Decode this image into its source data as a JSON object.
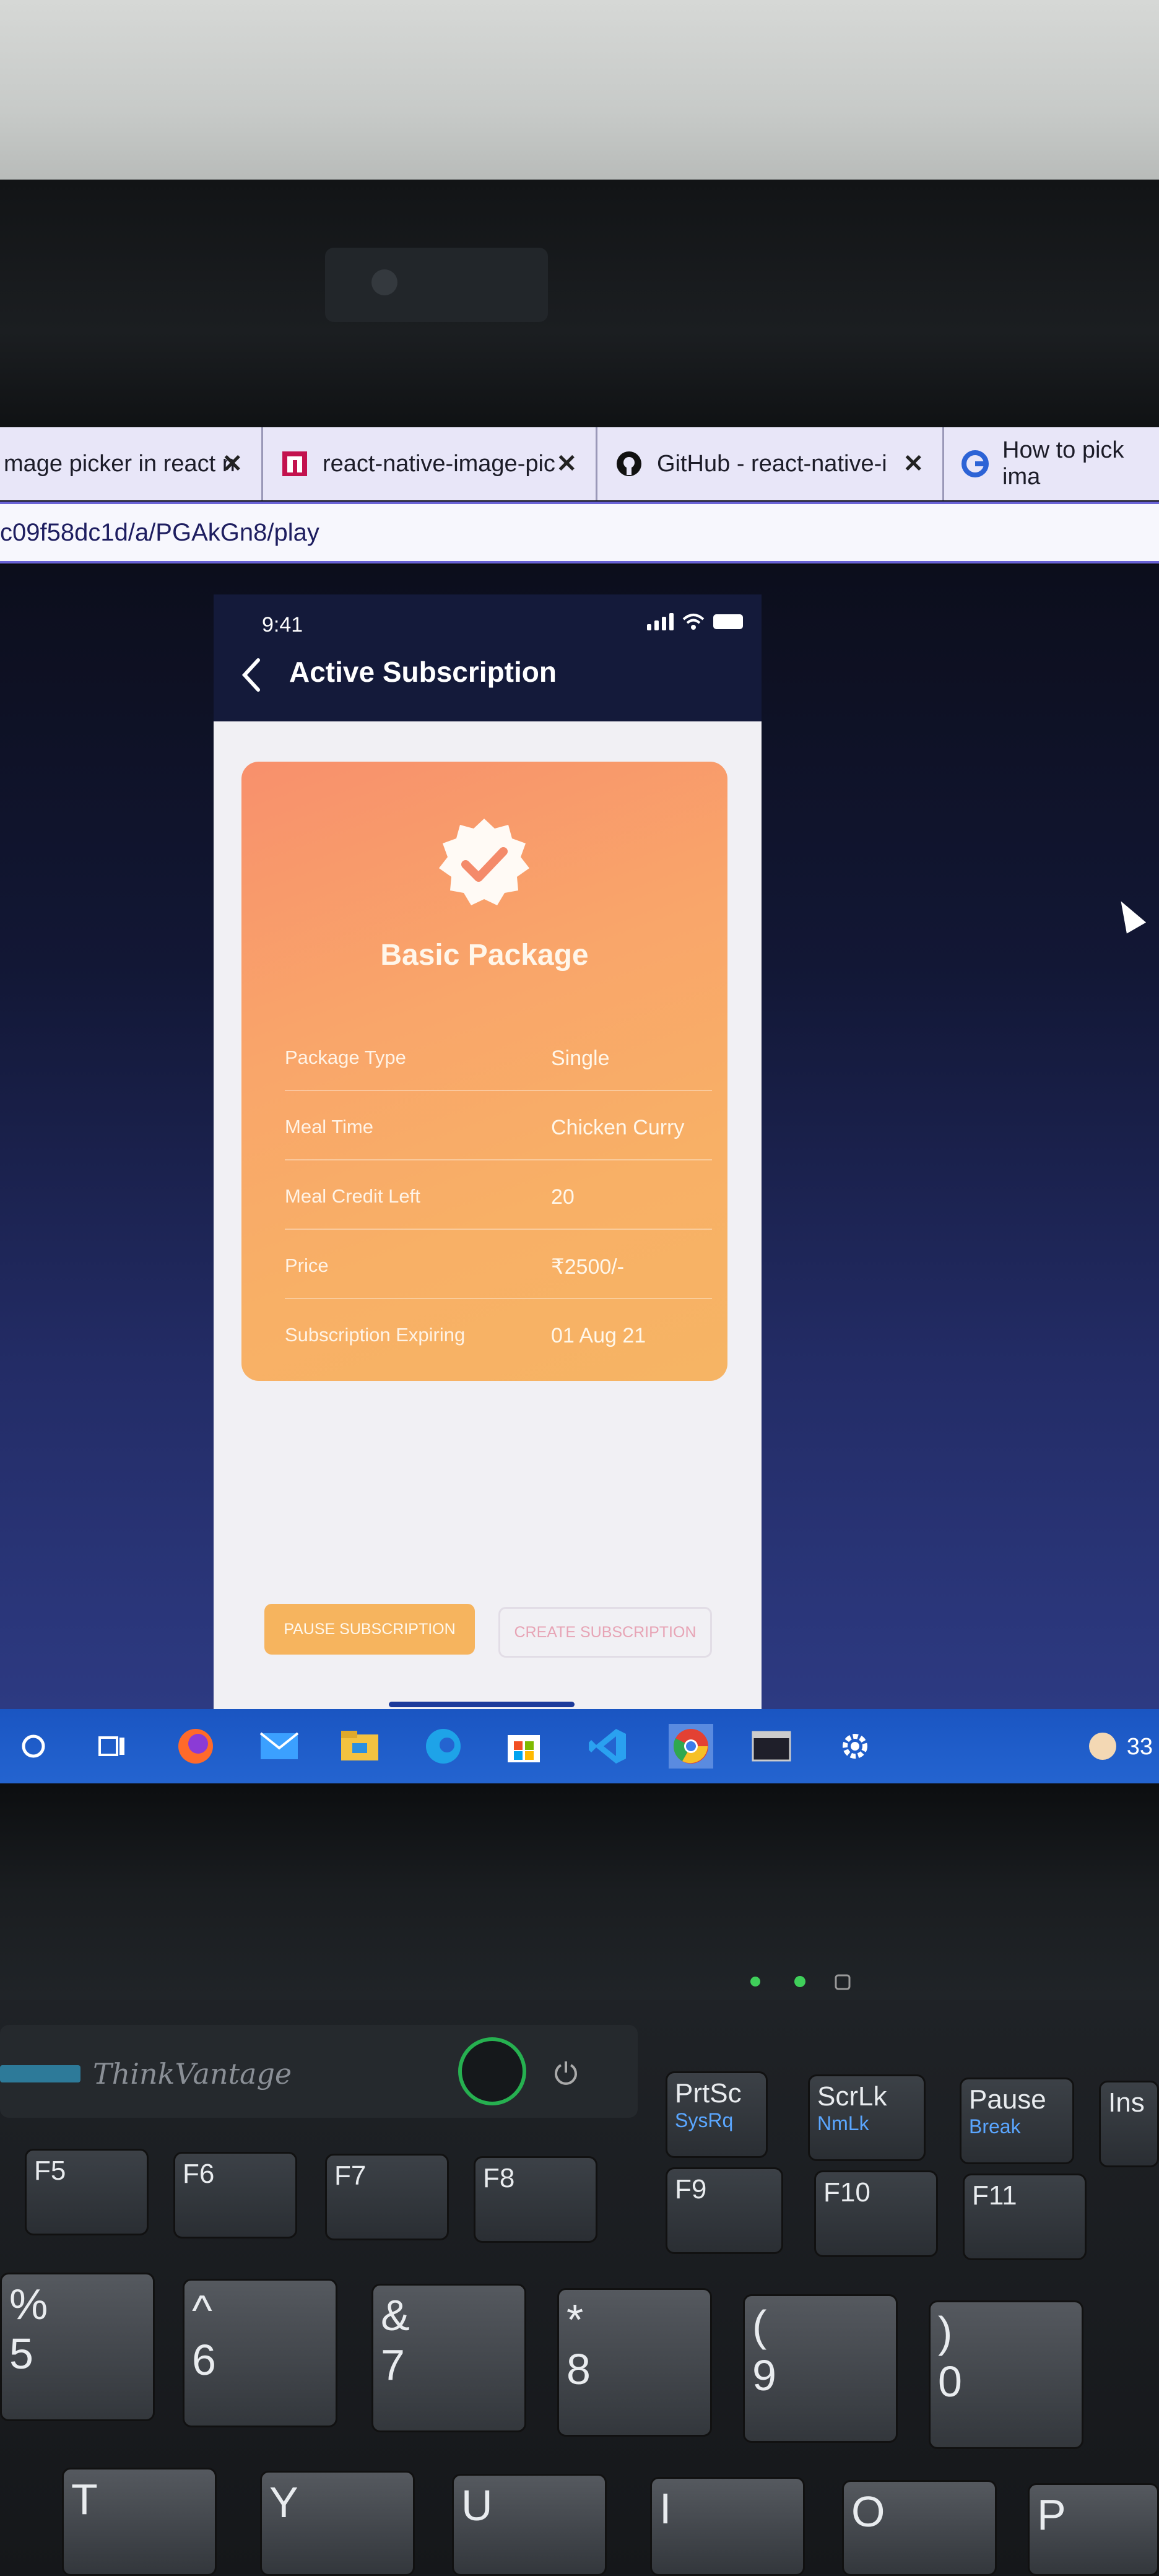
{
  "browser": {
    "tabs": [
      {
        "title": "mage picker in react n",
        "icon": "page-icon"
      },
      {
        "title": "react-native-image-pic",
        "icon": "npm-icon"
      },
      {
        "title": "GitHub - react-native-i",
        "icon": "github-icon"
      },
      {
        "title": "How to pick ima",
        "icon": "chrome-search-icon"
      }
    ],
    "address": "c09f58dc1d/a/PGAkGn8/play"
  },
  "phone": {
    "status_time": "9:41",
    "header_title": "Active Subscription",
    "card": {
      "title": "Basic Package",
      "rows": [
        {
          "label": "Package Type",
          "value": "Single"
        },
        {
          "label": "Meal Time",
          "value": "Chicken Curry"
        },
        {
          "label": "Meal Credit Left",
          "value": "20"
        },
        {
          "label": "Price",
          "value": "₹2500/-"
        },
        {
          "label": "Subscription Expiring",
          "value": "01 Aug 21"
        }
      ]
    },
    "buttons": {
      "pause": "PAUSE SUBSCRIPTION",
      "create": "CREATE SUBSCRIPTION"
    },
    "colors": {
      "header": "#141a3a",
      "card_start": "#f8906c",
      "card_end": "#f6b464",
      "accent": "#f6b45e"
    }
  },
  "taskbar": {
    "icons": [
      "cortana-circle-icon",
      "task-view-icon",
      "firefox-icon",
      "mail-icon",
      "file-explorer-icon",
      "edge-icon",
      "store-icon",
      "vscode-icon",
      "chrome-icon",
      "terminal-icon",
      "settings-gear-icon"
    ],
    "clock": "33"
  },
  "keyboard": {
    "brand": "ThinkVantage",
    "function_keys": [
      {
        "top": "F5",
        "bottom": ""
      },
      {
        "top": "F6",
        "bottom": ""
      },
      {
        "top": "F7",
        "bottom": ""
      },
      {
        "top": "F8",
        "bottom": ""
      },
      {
        "top": "F9",
        "bottom": ""
      },
      {
        "top": "F10",
        "bottom": ""
      },
      {
        "top": "F11",
        "bottom": ""
      }
    ],
    "system_keys": [
      {
        "top": "PrtSc",
        "bottom": "SysRq"
      },
      {
        "top": "ScrLk",
        "bottom": "NmLk"
      },
      {
        "top": "Pause",
        "bottom": "Break"
      },
      {
        "top": "Ins",
        "bottom": ""
      }
    ],
    "number_keys": [
      {
        "top": "%",
        "bottom": "5"
      },
      {
        "top": "^",
        "bottom": "6"
      },
      {
        "top": "&",
        "bottom": "7"
      },
      {
        "top": "*",
        "bottom": "8"
      },
      {
        "top": "(",
        "bottom": "9"
      },
      {
        "top": ")",
        "bottom": "0"
      }
    ],
    "letter_keys": [
      "T",
      "Y",
      "U",
      "I",
      "O",
      "P"
    ]
  }
}
